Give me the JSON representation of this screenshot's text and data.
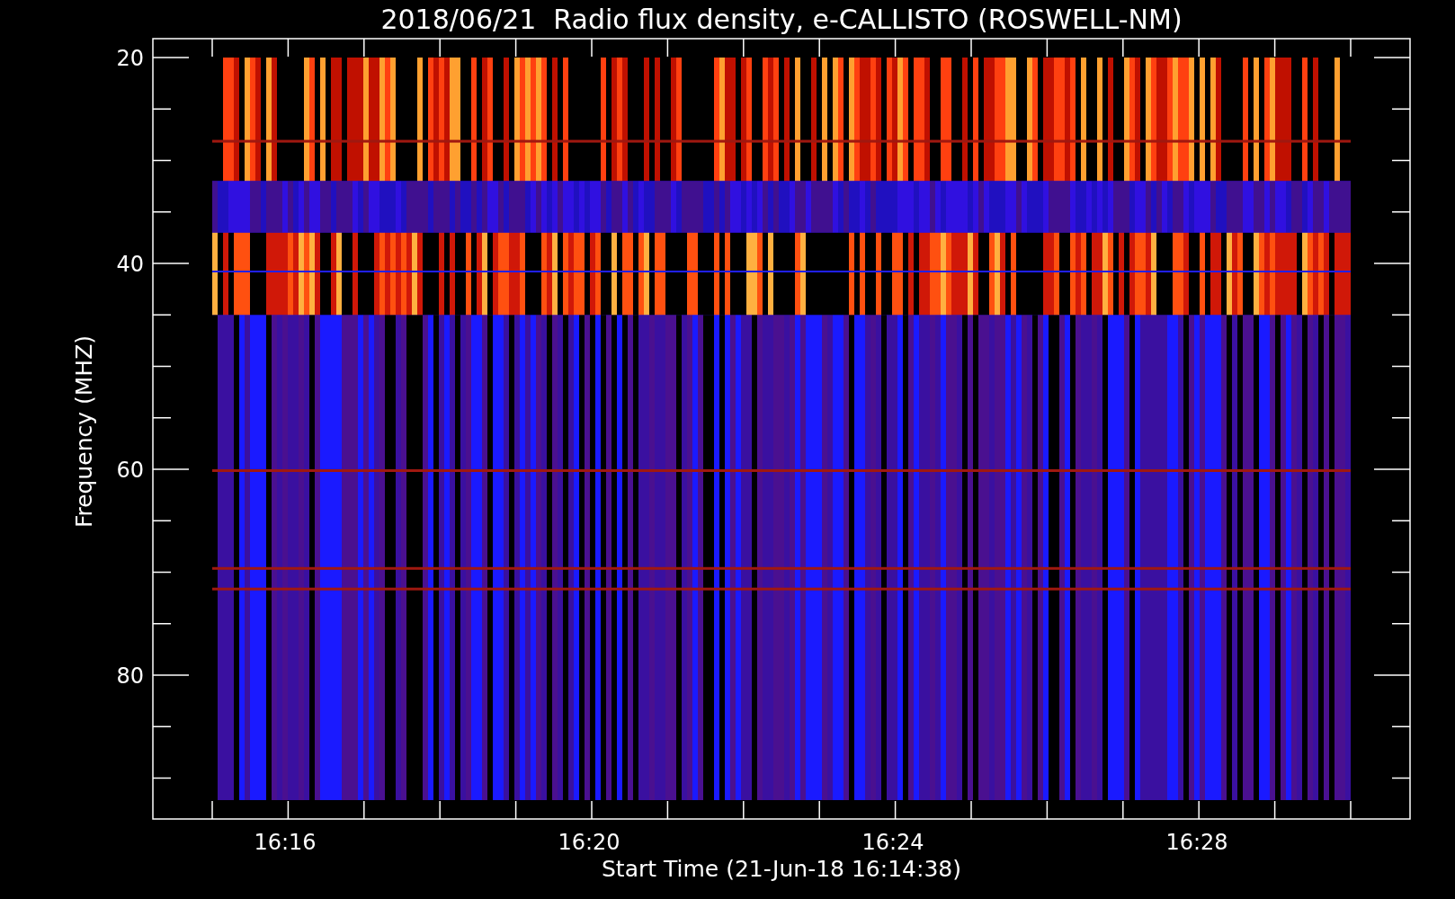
{
  "title": "2018/06/21  Radio flux density, e-CALLISTO (ROSWELL-NM)",
  "y_axis": {
    "label": "Frequency (MHZ)",
    "tick_labels": [
      "20",
      "40",
      "60",
      "80"
    ]
  },
  "x_axis": {
    "label": "Start Time (21-Jun-18 16:14:38)",
    "tick_labels": [
      "16:16",
      "16:20",
      "16:24",
      "16:28"
    ]
  }
}
